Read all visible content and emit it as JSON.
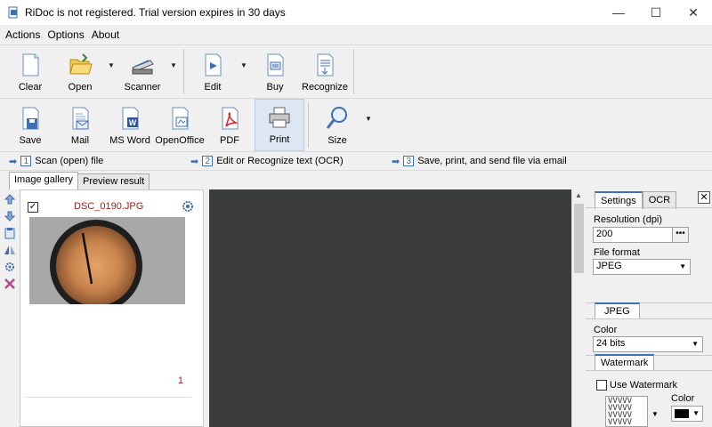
{
  "window": {
    "title": "RiDoc is not registered. Trial version expires in 30 days",
    "minimize": "—",
    "maximize": "☐",
    "close": "✕"
  },
  "menu": [
    "Actions",
    "Options",
    "About"
  ],
  "toolbar_row1": [
    {
      "label": "Clear",
      "icon": "page-icon"
    },
    {
      "label": "Open",
      "icon": "folder-open-icon",
      "dropdown": true
    },
    {
      "label": "Scanner",
      "icon": "scanner-icon",
      "dropdown": true
    },
    {
      "label": "Edit",
      "icon": "edit-icon",
      "dropdown": true
    },
    {
      "label": "Buy",
      "icon": "buy-icon"
    },
    {
      "label": "Recognize",
      "icon": "recognize-icon"
    }
  ],
  "toolbar_row2": [
    {
      "label": "Save",
      "icon": "save-icon"
    },
    {
      "label": "Mail",
      "icon": "mail-icon"
    },
    {
      "label": "MS Word",
      "icon": "word-icon"
    },
    {
      "label": "OpenOffice",
      "icon": "openoffice-icon"
    },
    {
      "label": "PDF",
      "icon": "pdf-icon"
    },
    {
      "label": "Print",
      "icon": "printer-icon"
    },
    {
      "label": "Size",
      "icon": "magnifier-icon",
      "dropdown": true
    }
  ],
  "steps": [
    {
      "num": "1",
      "text": "Scan (open) file"
    },
    {
      "num": "2",
      "text": "Edit or Recognize text (OCR)"
    },
    {
      "num": "3",
      "text": "Save, print, and send file via email"
    }
  ],
  "left_tabs": [
    "Image gallery",
    "Preview result"
  ],
  "gallery": {
    "item_name": "DSC_0190.JPG",
    "checked": "✓",
    "page_number": "1"
  },
  "right_panel": {
    "tabs": [
      "Settings",
      "OCR"
    ],
    "close": "✕",
    "resolution_label": "Resolution (dpi)",
    "resolution_value": "200",
    "resolution_button": "•••",
    "file_format_label": "File format",
    "file_format_value": "JPEG",
    "jpeg_tab": "JPEG",
    "color_label": "Color",
    "color_value": "24 bits",
    "watermark_tab": "Watermark",
    "use_watermark": "Use Watermark",
    "watermark_pattern": "VVVVV\nVVVVV\nVVVVV\nVVVVV",
    "color_picker_label": "Color",
    "color_picker_value": "#000000"
  },
  "colors": {
    "accent": "#3f6fb5",
    "filename": "#a51d1d",
    "preview_bg": "#3a3d3b"
  }
}
